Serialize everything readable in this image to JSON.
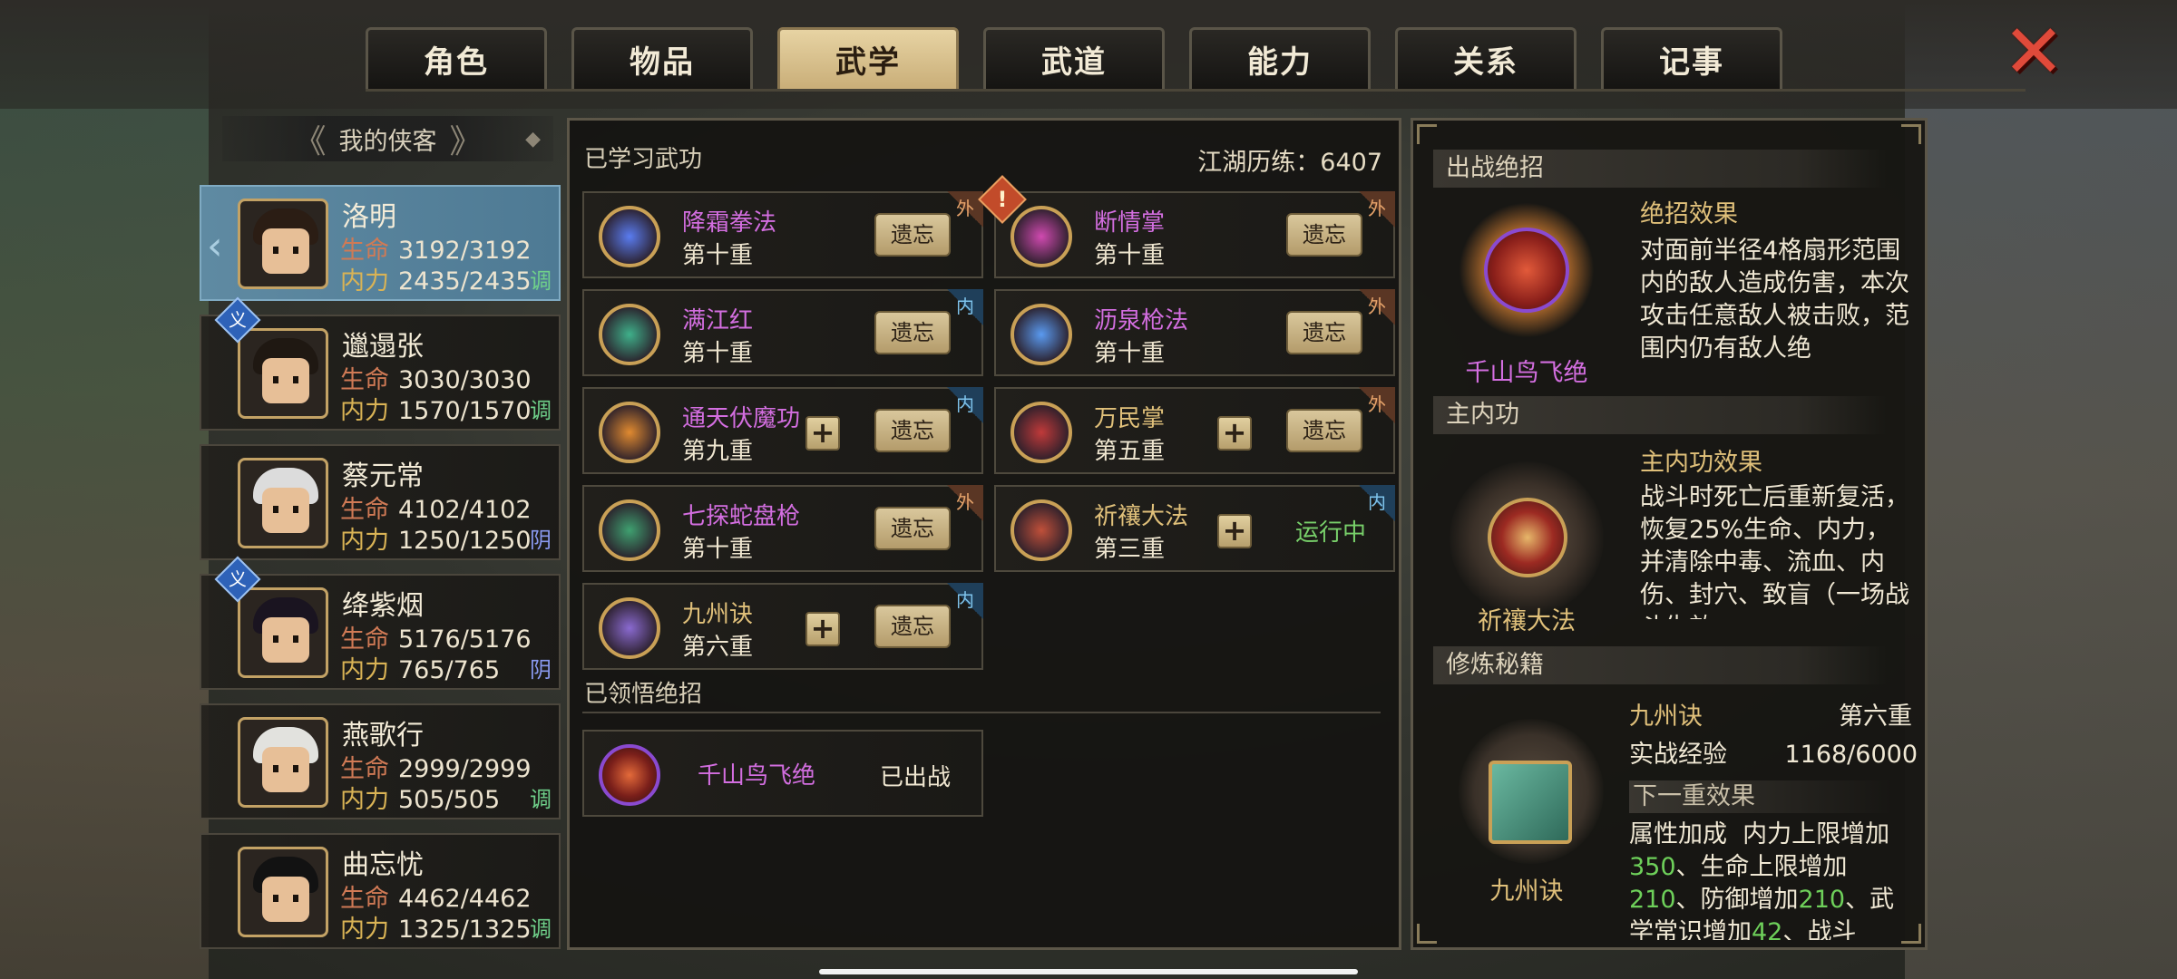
{
  "tabs": [
    "角色",
    "物品",
    "武学",
    "武道",
    "能力",
    "关系",
    "记事"
  ],
  "active_tab": "武学",
  "sidebar": {
    "header": "我的侠客",
    "characters": [
      {
        "name": "洛明",
        "hp_label": "生命",
        "hp": "3192/3192",
        "mp_label": "内力",
        "mp": "2435/2435",
        "tag": "调",
        "tag_color": "#6fd08a",
        "active": true,
        "badge": "",
        "hair": "#2b1d14"
      },
      {
        "name": "邋遢张",
        "hp_label": "生命",
        "hp": "3030/3030",
        "mp_label": "内力",
        "mp": "1570/1570",
        "tag": "调",
        "tag_color": "#6fd08a",
        "active": false,
        "badge": "义",
        "hair": "#1f1812"
      },
      {
        "name": "蔡元常",
        "hp_label": "生命",
        "hp": "4102/4102",
        "mp_label": "内力",
        "mp": "1250/1250",
        "tag": "阴",
        "tag_color": "#8a9af0",
        "active": false,
        "badge": "",
        "hair": "#dcdcdc"
      },
      {
        "name": "绛紫烟",
        "hp_label": "生命",
        "hp": "5176/5176",
        "mp_label": "内力",
        "mp": "765/765",
        "tag": "阴",
        "tag_color": "#8a9af0",
        "active": false,
        "badge": "义",
        "hair": "#1a1420"
      },
      {
        "name": "燕歌行",
        "hp_label": "生命",
        "hp": "2999/2999",
        "mp_label": "内力",
        "mp": "505/505",
        "tag": "调",
        "tag_color": "#6fd08a",
        "active": false,
        "badge": "",
        "hair": "#e2e2de"
      },
      {
        "name": "曲忘忧",
        "hp_label": "生命",
        "hp": "4462/4462",
        "mp_label": "内力",
        "mp": "1325/1325",
        "tag": "调",
        "tag_color": "#6fd08a",
        "active": false,
        "badge": "",
        "hair": "#121212"
      }
    ]
  },
  "main": {
    "learned_title": "已学习武功",
    "experience": "江湖历练：6407",
    "forget_label": "遗忘",
    "skills": [
      {
        "name": "降霜拳法",
        "level": "第十重",
        "color": "#d36ee0",
        "type": "外",
        "type_class": "wai",
        "plus": false,
        "action": "遗忘",
        "icon_color": "#5a7cf0",
        "alert": false
      },
      {
        "name": "断情掌",
        "level": "第十重",
        "color": "#d36ee0",
        "type": "外",
        "type_class": "wai",
        "plus": false,
        "action": "遗忘",
        "icon_color": "#d04ab0",
        "alert": true
      },
      {
        "name": "满江红",
        "level": "第十重",
        "color": "#d36ee0",
        "type": "内",
        "type_class": "nei",
        "plus": false,
        "action": "遗忘",
        "icon_color": "#3fb08a",
        "alert": false
      },
      {
        "name": "沥泉枪法",
        "level": "第十重",
        "color": "#d36ee0",
        "type": "外",
        "type_class": "wai",
        "plus": false,
        "action": "遗忘",
        "icon_color": "#5a9af0",
        "alert": false
      },
      {
        "name": "通天伏魔功",
        "level": "第九重",
        "color": "#d36ee0",
        "type": "内",
        "type_class": "nei",
        "plus": true,
        "action": "遗忘",
        "icon_color": "#e08a30",
        "alert": false
      },
      {
        "name": "万民掌",
        "level": "第五重",
        "color": "#e0c07a",
        "type": "外",
        "type_class": "wai",
        "plus": true,
        "action": "遗忘",
        "icon_color": "#c03a3a",
        "alert": false
      },
      {
        "name": "七探蛇盘枪",
        "level": "第十重",
        "color": "#d36ee0",
        "type": "外",
        "type_class": "wai",
        "plus": false,
        "action": "遗忘",
        "icon_color": "#3fa070",
        "alert": false
      },
      {
        "name": "祈禳大法",
        "level": "第三重",
        "color": "#e0c07a",
        "type": "内",
        "type_class": "nei",
        "plus": true,
        "action": "运行中",
        "icon_color": "#c0503a",
        "alert": false
      },
      {
        "name": "九州诀",
        "level": "第六重",
        "color": "#e0c07a",
        "type": "内",
        "type_class": "nei",
        "plus": true,
        "action": "遗忘",
        "icon_color": "#8a6ad0",
        "alert": false
      }
    ],
    "ultimate_title": "已领悟绝招",
    "ultimate": {
      "name": "千山鸟飞绝",
      "status": "已出战"
    }
  },
  "right": {
    "battle_title": "出战绝招",
    "battle_name": "千山鸟飞绝",
    "battle_effect_head": "绝招效果",
    "battle_effect": "对面前半径4格扇形范围内的敌人造成伤害，本次攻击任意敌人被击败，范围内仍有敌人绝",
    "inner_title": "主内功",
    "inner_name": "祈禳大法",
    "inner_effect_head": "主内功效果",
    "inner_effect": "战斗时死亡后重新复活，恢复25%生命、内力，并清除中毒、流血、内伤、封穴、致盲（一场战斗生效",
    "book_title": "修炼秘籍",
    "book_name": "九州诀",
    "book_level": "第六重",
    "book_exp_label": "实战经验",
    "book_exp": "1168/6000",
    "next_label": "下一重效果",
    "next_attr_label": "属性加成",
    "next_text_1": "内力上限增加",
    "next_val_1": "350",
    "next_text_2": "、生命上限增加",
    "next_val_2": "210",
    "next_text_3": "、防御增加",
    "next_val_3": "210",
    "next_text_4": "、武学常识增加",
    "next_val_4": "42",
    "next_text_5": "、战斗"
  },
  "colors": {
    "accent_gold": "#e0c07a",
    "purple_skill": "#d36ee0",
    "green_value": "#6ed05a",
    "close_red": "#e04a3a"
  },
  "icons": {
    "close": "close-x-icon"
  }
}
